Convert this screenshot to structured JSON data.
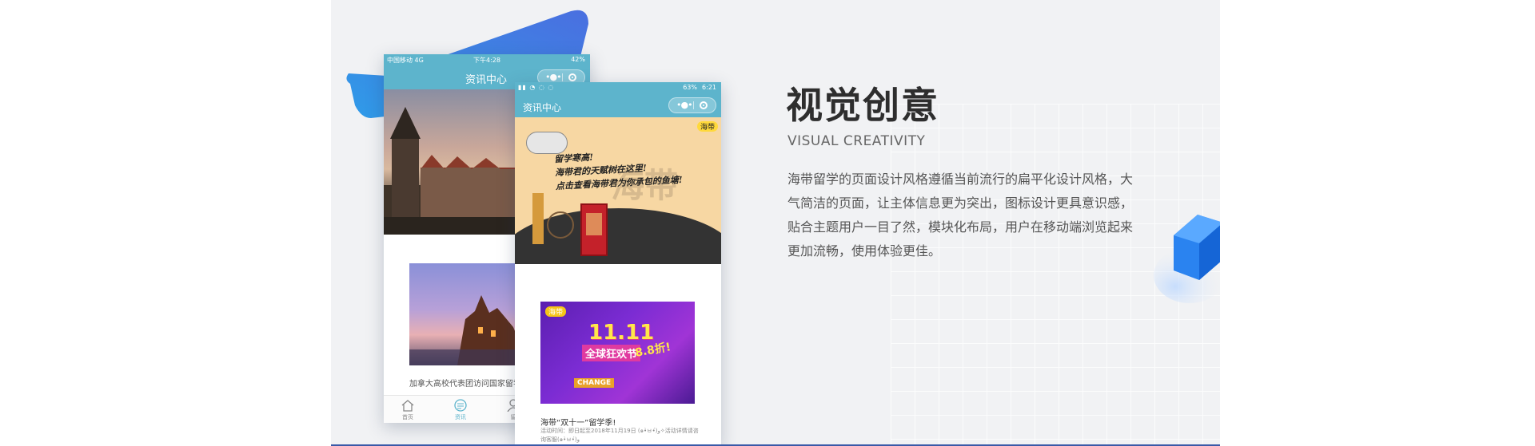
{
  "section": {
    "title": "视觉创意",
    "subtitle": "VISUAL CREATIVITY",
    "description": "海带留学的页面设计风格遵循当前流行的扁平化设计风格，大气简洁的页面，让主体信息更为突出，图标设计更具意识感，贴合主题用户一目了然，模块化布局，用户在移动端浏览起来更加流畅，使用体验更佳。"
  },
  "phone1": {
    "carrier": "中国移动 4G",
    "time": "下午4:28",
    "battery": "42%",
    "nav_title": "资讯中心",
    "card_caption": "加拿大高校代表团访问国家留学基",
    "tabs": [
      {
        "label": "首页",
        "icon": "home-icon"
      },
      {
        "label": "资讯",
        "icon": "news-icon"
      },
      {
        "label": "留",
        "icon": "user-icon"
      }
    ]
  },
  "phone2": {
    "time": "6:21",
    "battery": "63%",
    "nav_title": "资讯中心",
    "banner": {
      "logo": "海带",
      "line1": "留学寒高!",
      "line2": "海带君的天赋树在这里!",
      "line3": "点击查看海带君为你承包的鱼塘!",
      "watermark": "海带"
    },
    "card": {
      "logo": "海带",
      "big": "11.11",
      "festival": "全球狂欢节",
      "discount": "8.8折!",
      "change": "CHANGE",
      "title": "海带“双十一”留学季!",
      "subtitle": "活动时间：即日起至2018年11月19日 (๑•̀ㅂ•́)و✧活动详情请咨询客服(๑•̀ㅂ•́)و"
    }
  },
  "colors": {
    "accent": "#5db4cc",
    "background": "#f1f2f4",
    "deco_blue": "#1e7be8"
  }
}
